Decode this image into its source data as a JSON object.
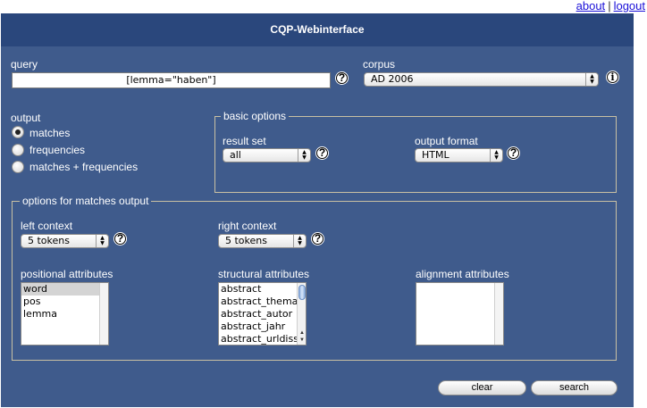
{
  "toplinks": {
    "about": "about",
    "separator": "|",
    "logout": "logout"
  },
  "header": {
    "title": "CQP-Webinterface"
  },
  "query": {
    "label": "query",
    "value": "[lemma=\"haben\"]"
  },
  "corpus": {
    "label": "corpus",
    "selected": "AD 2006"
  },
  "output": {
    "label": "output",
    "options": [
      {
        "label": "matches",
        "checked": true
      },
      {
        "label": "frequencies",
        "checked": false
      },
      {
        "label": "matches + frequencies",
        "checked": false
      }
    ]
  },
  "basic_options": {
    "legend": "basic options",
    "result_set": {
      "label": "result set",
      "selected": "all"
    },
    "output_format": {
      "label": "output format",
      "selected": "HTML"
    }
  },
  "matches_output": {
    "legend": "options for matches output",
    "left_context": {
      "label": "left context",
      "selected": "5 tokens"
    },
    "right_context": {
      "label": "right context",
      "selected": "5 tokens"
    },
    "positional_attributes": {
      "label": "positional attributes",
      "items": [
        "word",
        "pos",
        "lemma"
      ],
      "selected_index": 0
    },
    "structural_attributes": {
      "label": "structural attributes",
      "items": [
        "abstract",
        "abstract_thema",
        "abstract_autor",
        "abstract_jahr",
        "abstract_urldiss"
      ]
    },
    "alignment_attributes": {
      "label": "alignment attributes",
      "items": []
    }
  },
  "buttons": {
    "clear": "clear",
    "search": "search"
  },
  "colors": {
    "panel": "#3f5b8c",
    "header": "#2a477c",
    "link": "#1a10d8"
  },
  "icons": {
    "help": "question-mark-icon",
    "info": "info-icon",
    "select": "up-down-arrows-icon"
  }
}
